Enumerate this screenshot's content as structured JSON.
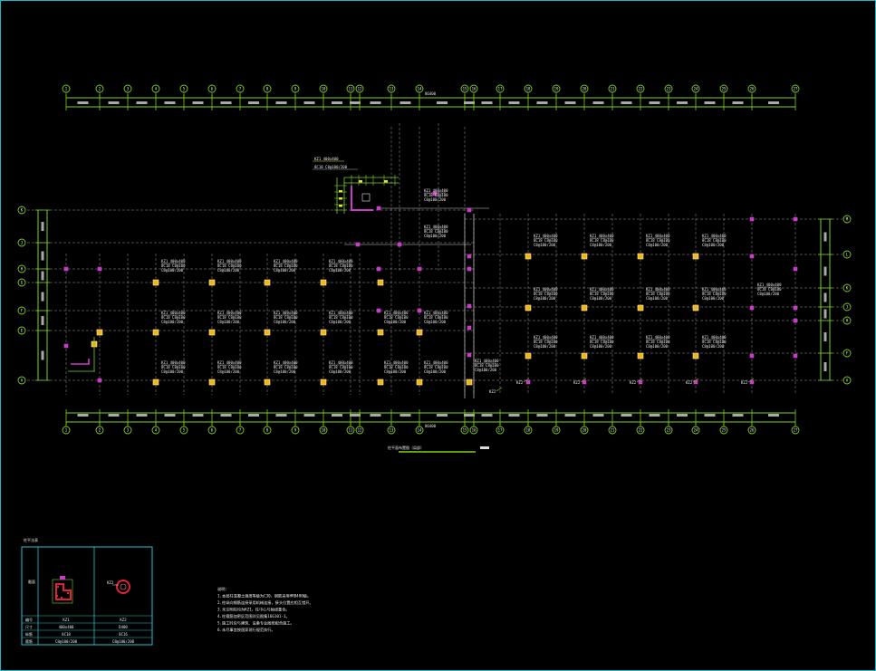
{
  "colors": {
    "background": "#000000",
    "frame": "#19b9c9",
    "dimension": "#7cd21a",
    "grid_line": "#9a9a9a",
    "axis_bubble": "#7cd21a",
    "column_yellow": "#f2b41e",
    "column_magenta": "#c83cc8",
    "text_white": "#ececec",
    "text_yellow": "#e8e23a",
    "red_detail": "#e01f3a"
  },
  "top_axes": [
    "1",
    "2",
    "3",
    "4",
    "5",
    "6",
    "7",
    "8",
    "9",
    "10",
    "11",
    "12",
    "13",
    "14",
    "15",
    "16",
    "17",
    "18",
    "19",
    "20",
    "21",
    "22",
    "23",
    "24",
    "25",
    "26",
    "27"
  ],
  "top_overall_dim": "86400",
  "bottom_overall_dim": "86400",
  "left_axes": [
    "K",
    "J",
    "H",
    "G",
    "F",
    "E",
    "A"
  ],
  "right_axes": [
    "M",
    "L",
    "K",
    "J",
    "H",
    "F",
    "A"
  ],
  "bay_dim": "3600",
  "column_label_lines": [
    "KZ1 400x400",
    "8C18 C8@100",
    "C8@100/200"
  ],
  "legend_title": "柱平法表",
  "legend_cols": [
    "KZ1",
    "KZ2"
  ],
  "legend_rows": [
    {
      "label": "编号",
      "a": "KZ1",
      "b": "KZ2"
    },
    {
      "label": "尺寸",
      "a": "400x400",
      "b": "D400"
    },
    {
      "label": "纵筋",
      "a": "8C18",
      "b": "8C16"
    },
    {
      "label": "箍筋",
      "a": "C8@100/200",
      "b": "C8@100/200"
    }
  ],
  "notes": [
    "说明：",
    "1.本层柱混凝土强度等级为C30，钢筋采用HRB400级。",
    "2.柱纵向钢筋连接采用机械连接，接头位置应相互错开。",
    "3.未注明柱均为KZ1，柱中心与轴线重合。",
    "4.柱箍筋加密区范围详见图集16G101-1。",
    "5.施工时应与建筑、设备专业图纸配合施工。",
    "6.未尽事宜按国家现行规范执行。"
  ],
  "drawing_caption": "柱平面布置图"
}
